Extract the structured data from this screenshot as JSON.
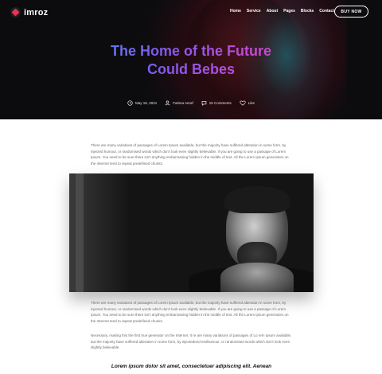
{
  "brand": {
    "name": "imroz"
  },
  "nav": {
    "items": [
      "Home",
      "Service",
      "About",
      "Pages",
      "Blocks",
      "Contact"
    ]
  },
  "header": {
    "cta_label": "BUY NOW"
  },
  "hero": {
    "title_line1": "The Home of the Future",
    "title_line2": "Could Bebes"
  },
  "meta": {
    "date": "May 18, 2021",
    "author": "Fatima Aeraf",
    "comments": "15 Comments",
    "like": "Like"
  },
  "content": {
    "paragraph1": "There are many variations of passages of Lorem Ipsum available, but the majority have suffered alteration in some form, by injected humour, or randomised words which don't look even slightly believable. If you are going to use a passage of Lorem Ipsum. You need to be sure there isn't anything embarrassing hidden in the middle of text. All the Lorem Ipsum generators on the Internet tend to repeat predefined chunks.",
    "paragraph2": "There are many variations of passages of Lorem Ipsum available, but the majority have suffered alteration in some form, by injected humour, or randomised words which don't look even slightly believable. If you are going to use a passage of Lorem Ipsum. You need to be sure there isn't anything embarrassing hidden in the middle of text. All the Lorem Ipsum generators on the Internet tend to repeat predefined chunks.",
    "paragraph3": "Necessary, making this the first true generator on the Internet. It re are many variations of passages of Lo rem Ipsum available, but the majority have suffered alteration in some form, by injectedeed eedhumour, or randomised words which don't look even slightly believable.",
    "quote": "Lorem ipsum dolor sit amet, consectetuer adipiscing elit. Aenean"
  },
  "colors": {
    "accent_gradient_start": "#2fb6e8",
    "accent_gradient_mid": "#7b5cf0",
    "accent_gradient_end": "#ee3d6e",
    "logo_mark": "#e8344e",
    "hero_bg": "#0c0c0f"
  },
  "icons": {
    "date": "clock-icon",
    "author": "user-icon",
    "comments": "comment-icon",
    "like": "heart-icon"
  }
}
